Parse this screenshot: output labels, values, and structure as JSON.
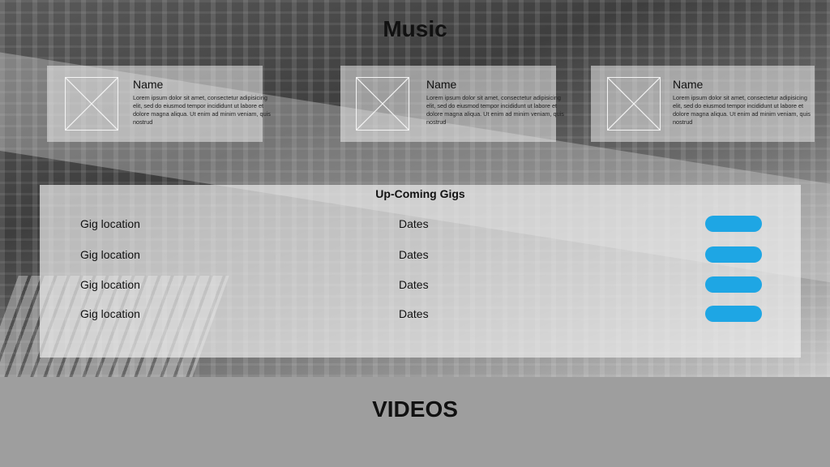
{
  "music": {
    "title": "Music",
    "cards": [
      {
        "name": "Name",
        "description": "Lorem ipsum dolor sit amet, consectetur adipisicing elit, sed do eiusmod tempor incididunt ut labore et dolore magna aliqua. Ut enim ad minim veniam, quis nostrud"
      },
      {
        "name": "Name",
        "description": "Lorem ipsum dolor sit amet, consectetur adipisicing elit, sed do eiusmod tempor incididunt ut labore et dolore magna aliqua. Ut enim ad minim veniam, quis nostrud"
      },
      {
        "name": "Name",
        "description": "Lorem ipsum dolor sit amet, consectetur adipisicing elit, sed do eiusmod tempor incididunt ut labore et dolore magna aliqua. Ut enim ad minim veniam, quis nostrud"
      }
    ]
  },
  "gigs": {
    "title": "Up-Coming Gigs",
    "rows": [
      {
        "location": "Gig location",
        "dates": "Dates"
      },
      {
        "location": "Gig location",
        "dates": "Dates"
      },
      {
        "location": "Gig location",
        "dates": "Dates"
      },
      {
        "location": "Gig location",
        "dates": "Dates"
      }
    ]
  },
  "videos": {
    "title": "VIDEOS"
  },
  "colors": {
    "accent": "#1ea6e4",
    "footer": "#9e9e9e"
  }
}
